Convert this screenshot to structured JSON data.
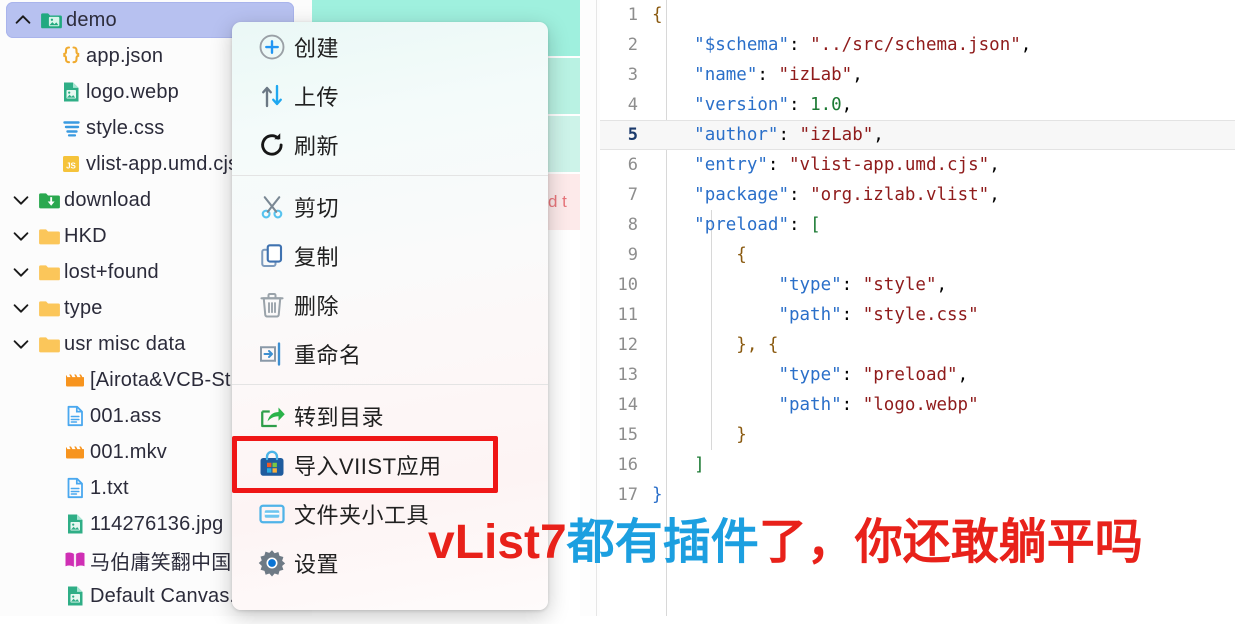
{
  "file_tree": [
    {
      "twisty": "chevron-up",
      "icon": "folder-image-green",
      "label": "demo",
      "selected": true,
      "indent": 0
    },
    {
      "twisty": "none",
      "icon": "json-braces",
      "label": "app.json",
      "selected": false,
      "indent": 1
    },
    {
      "twisty": "none",
      "icon": "image-file-green",
      "label": "logo.webp",
      "selected": false,
      "indent": 1
    },
    {
      "twisty": "none",
      "icon": "css-file",
      "label": "style.css",
      "selected": false,
      "indent": 1
    },
    {
      "twisty": "none",
      "icon": "js-file",
      "label": "vlist-app.umd.cjs",
      "selected": false,
      "indent": 1
    },
    {
      "twisty": "chevron-down",
      "icon": "folder-download-green",
      "label": "download",
      "selected": false,
      "indent": 0
    },
    {
      "twisty": "chevron-down",
      "icon": "folder-yellow",
      "label": "HKD",
      "selected": false,
      "indent": 0
    },
    {
      "twisty": "chevron-down",
      "icon": "folder-yellow",
      "label": "lost+found",
      "selected": false,
      "indent": 0
    },
    {
      "twisty": "chevron-down",
      "icon": "folder-yellow",
      "label": "type",
      "selected": false,
      "indent": 0
    },
    {
      "twisty": "chevron-down",
      "icon": "folder-yellow",
      "label": "usr misc data",
      "selected": false,
      "indent": 0
    },
    {
      "twisty": "none",
      "icon": "video-file-orange",
      "label": "[Airota&VCB-St",
      "selected": false,
      "indent": 2
    },
    {
      "twisty": "none",
      "icon": "text-file-blue",
      "label": "001.ass",
      "selected": false,
      "indent": 2
    },
    {
      "twisty": "none",
      "icon": "video-file-orange",
      "label": "001.mkv",
      "selected": false,
      "indent": 2
    },
    {
      "twisty": "none",
      "icon": "text-file-blue",
      "label": "1.txt",
      "selected": false,
      "indent": 2
    },
    {
      "twisty": "none",
      "icon": "image-file-green",
      "label": "114276136.jpg",
      "selected": false,
      "indent": 2
    },
    {
      "twisty": "none",
      "icon": "book-magenta",
      "label": "马伯庸笑翻中国",
      "selected": false,
      "indent": 2
    },
    {
      "twisty": "none",
      "icon": "image-file-green",
      "label": "Default Canvas.tlab",
      "selected": false,
      "indent": 2
    }
  ],
  "background_panel": {
    "partial_text_fragment": "d t"
  },
  "context_menu": {
    "groups": [
      [
        {
          "icon": "plus-circle-icon",
          "label": "创建"
        },
        {
          "icon": "upload-arrows-icon",
          "label": "上传"
        },
        {
          "icon": "refresh-icon",
          "label": "刷新"
        }
      ],
      [
        {
          "icon": "scissors-icon",
          "label": "剪切"
        },
        {
          "icon": "copy-icon",
          "label": "复制"
        },
        {
          "icon": "trash-icon",
          "label": "删除"
        },
        {
          "icon": "rename-icon",
          "label": "重命名"
        }
      ],
      [
        {
          "icon": "share-export-icon",
          "label": "转到目录"
        },
        {
          "icon": "store-bag-icon",
          "label": "导入VIIST应用",
          "highlighted": true
        },
        {
          "icon": "folder-widget-icon",
          "label": "文件夹小工具"
        },
        {
          "icon": "gear-icon",
          "label": "设置"
        }
      ]
    ]
  },
  "editor": {
    "active_line": 5,
    "lines": [
      {
        "no": "1",
        "tokens": [
          {
            "t": "{",
            "c": "p"
          }
        ]
      },
      {
        "no": "2",
        "tokens": [
          {
            "t": "    ",
            "c": "x"
          },
          {
            "t": "\"$schema\"",
            "c": "k"
          },
          {
            "t": ": ",
            "c": "x"
          },
          {
            "t": "\"../src/schema.json\"",
            "c": "s"
          },
          {
            "t": ",",
            "c": "x"
          }
        ]
      },
      {
        "no": "3",
        "tokens": [
          {
            "t": "    ",
            "c": "x"
          },
          {
            "t": "\"name\"",
            "c": "k"
          },
          {
            "t": ": ",
            "c": "x"
          },
          {
            "t": "\"izLab\"",
            "c": "s"
          },
          {
            "t": ",",
            "c": "x"
          }
        ]
      },
      {
        "no": "4",
        "tokens": [
          {
            "t": "    ",
            "c": "x"
          },
          {
            "t": "\"version\"",
            "c": "k"
          },
          {
            "t": ": ",
            "c": "x"
          },
          {
            "t": "1.0",
            "c": "n"
          },
          {
            "t": ",",
            "c": "x"
          }
        ]
      },
      {
        "no": "5",
        "tokens": [
          {
            "t": "    ",
            "c": "x"
          },
          {
            "t": "\"author\"",
            "c": "k"
          },
          {
            "t": ": ",
            "c": "x"
          },
          {
            "t": "\"izLab\"",
            "c": "s"
          },
          {
            "t": ",",
            "c": "x"
          }
        ]
      },
      {
        "no": "6",
        "tokens": [
          {
            "t": "    ",
            "c": "x"
          },
          {
            "t": "\"entry\"",
            "c": "k"
          },
          {
            "t": ": ",
            "c": "x"
          },
          {
            "t": "\"vlist-app.umd.cjs\"",
            "c": "s"
          },
          {
            "t": ",",
            "c": "x"
          }
        ]
      },
      {
        "no": "7",
        "tokens": [
          {
            "t": "    ",
            "c": "x"
          },
          {
            "t": "\"package\"",
            "c": "k"
          },
          {
            "t": ": ",
            "c": "x"
          },
          {
            "t": "\"org.izlab.vlist\"",
            "c": "s"
          },
          {
            "t": ",",
            "c": "x"
          }
        ]
      },
      {
        "no": "8",
        "tokens": [
          {
            "t": "    ",
            "c": "x"
          },
          {
            "t": "\"preload\"",
            "c": "k"
          },
          {
            "t": ": ",
            "c": "x"
          },
          {
            "t": "[",
            "c": "br"
          }
        ]
      },
      {
        "no": "9",
        "tokens": [
          {
            "t": "        ",
            "c": "x"
          },
          {
            "t": "{",
            "c": "p"
          }
        ]
      },
      {
        "no": "10",
        "tokens": [
          {
            "t": "            ",
            "c": "x"
          },
          {
            "t": "\"type\"",
            "c": "k"
          },
          {
            "t": ": ",
            "c": "x"
          },
          {
            "t": "\"style\"",
            "c": "s"
          },
          {
            "t": ",",
            "c": "x"
          }
        ]
      },
      {
        "no": "11",
        "tokens": [
          {
            "t": "            ",
            "c": "x"
          },
          {
            "t": "\"path\"",
            "c": "k"
          },
          {
            "t": ": ",
            "c": "x"
          },
          {
            "t": "\"style.css\"",
            "c": "s"
          }
        ]
      },
      {
        "no": "12",
        "tokens": [
          {
            "t": "        ",
            "c": "x"
          },
          {
            "t": "}, {",
            "c": "p"
          }
        ]
      },
      {
        "no": "13",
        "tokens": [
          {
            "t": "            ",
            "c": "x"
          },
          {
            "t": "\"type\"",
            "c": "k"
          },
          {
            "t": ": ",
            "c": "x"
          },
          {
            "t": "\"preload\"",
            "c": "s"
          },
          {
            "t": ",",
            "c": "x"
          }
        ]
      },
      {
        "no": "14",
        "tokens": [
          {
            "t": "            ",
            "c": "x"
          },
          {
            "t": "\"path\"",
            "c": "k"
          },
          {
            "t": ": ",
            "c": "x"
          },
          {
            "t": "\"logo.webp\"",
            "c": "s"
          }
        ]
      },
      {
        "no": "15",
        "tokens": [
          {
            "t": "        ",
            "c": "x"
          },
          {
            "t": "}",
            "c": "p"
          }
        ]
      },
      {
        "no": "16",
        "tokens": [
          {
            "t": "    ",
            "c": "x"
          },
          {
            "t": "]",
            "c": "br"
          }
        ]
      },
      {
        "no": "17",
        "tokens": [
          {
            "t": "}",
            "c": "blu"
          }
        ]
      }
    ]
  },
  "annotation": {
    "part1": "vList7",
    "part2": "都有插件",
    "part3": "了，你还敢躺平吗"
  },
  "colors": {
    "selection": "#b7c1f0",
    "highlight_box": "#ef1616",
    "annotation_red": "#e8211a",
    "annotation_blue": "#1c9fe0",
    "teal_panel": "#9ff0de",
    "json_key": "#2a6fc9",
    "json_string": "#8f1b1b",
    "json_number": "#1c7a34"
  }
}
